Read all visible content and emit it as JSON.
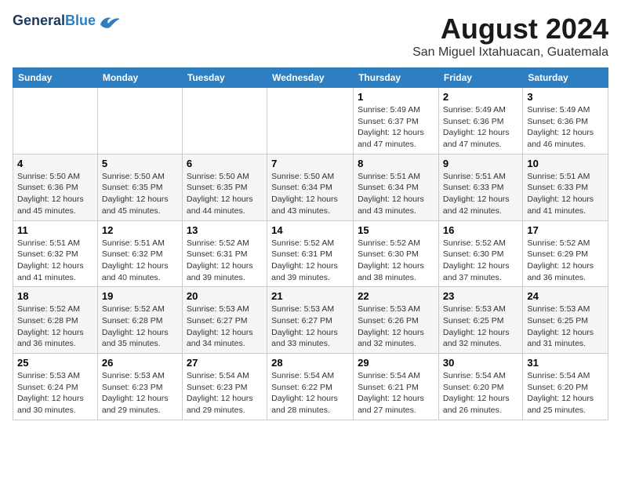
{
  "header": {
    "logo_general": "General",
    "logo_blue": "Blue",
    "month_title": "August 2024",
    "location": "San Miguel Ixtahuacan, Guatemala"
  },
  "days_of_week": [
    "Sunday",
    "Monday",
    "Tuesday",
    "Wednesday",
    "Thursday",
    "Friday",
    "Saturday"
  ],
  "weeks": [
    [
      {
        "day": "",
        "info": ""
      },
      {
        "day": "",
        "info": ""
      },
      {
        "day": "",
        "info": ""
      },
      {
        "day": "",
        "info": ""
      },
      {
        "day": "1",
        "info": "Sunrise: 5:49 AM\nSunset: 6:37 PM\nDaylight: 12 hours\nand 47 minutes."
      },
      {
        "day": "2",
        "info": "Sunrise: 5:49 AM\nSunset: 6:36 PM\nDaylight: 12 hours\nand 47 minutes."
      },
      {
        "day": "3",
        "info": "Sunrise: 5:49 AM\nSunset: 6:36 PM\nDaylight: 12 hours\nand 46 minutes."
      }
    ],
    [
      {
        "day": "4",
        "info": "Sunrise: 5:50 AM\nSunset: 6:36 PM\nDaylight: 12 hours\nand 45 minutes."
      },
      {
        "day": "5",
        "info": "Sunrise: 5:50 AM\nSunset: 6:35 PM\nDaylight: 12 hours\nand 45 minutes."
      },
      {
        "day": "6",
        "info": "Sunrise: 5:50 AM\nSunset: 6:35 PM\nDaylight: 12 hours\nand 44 minutes."
      },
      {
        "day": "7",
        "info": "Sunrise: 5:50 AM\nSunset: 6:34 PM\nDaylight: 12 hours\nand 43 minutes."
      },
      {
        "day": "8",
        "info": "Sunrise: 5:51 AM\nSunset: 6:34 PM\nDaylight: 12 hours\nand 43 minutes."
      },
      {
        "day": "9",
        "info": "Sunrise: 5:51 AM\nSunset: 6:33 PM\nDaylight: 12 hours\nand 42 minutes."
      },
      {
        "day": "10",
        "info": "Sunrise: 5:51 AM\nSunset: 6:33 PM\nDaylight: 12 hours\nand 41 minutes."
      }
    ],
    [
      {
        "day": "11",
        "info": "Sunrise: 5:51 AM\nSunset: 6:32 PM\nDaylight: 12 hours\nand 41 minutes."
      },
      {
        "day": "12",
        "info": "Sunrise: 5:51 AM\nSunset: 6:32 PM\nDaylight: 12 hours\nand 40 minutes."
      },
      {
        "day": "13",
        "info": "Sunrise: 5:52 AM\nSunset: 6:31 PM\nDaylight: 12 hours\nand 39 minutes."
      },
      {
        "day": "14",
        "info": "Sunrise: 5:52 AM\nSunset: 6:31 PM\nDaylight: 12 hours\nand 39 minutes."
      },
      {
        "day": "15",
        "info": "Sunrise: 5:52 AM\nSunset: 6:30 PM\nDaylight: 12 hours\nand 38 minutes."
      },
      {
        "day": "16",
        "info": "Sunrise: 5:52 AM\nSunset: 6:30 PM\nDaylight: 12 hours\nand 37 minutes."
      },
      {
        "day": "17",
        "info": "Sunrise: 5:52 AM\nSunset: 6:29 PM\nDaylight: 12 hours\nand 36 minutes."
      }
    ],
    [
      {
        "day": "18",
        "info": "Sunrise: 5:52 AM\nSunset: 6:28 PM\nDaylight: 12 hours\nand 36 minutes."
      },
      {
        "day": "19",
        "info": "Sunrise: 5:52 AM\nSunset: 6:28 PM\nDaylight: 12 hours\nand 35 minutes."
      },
      {
        "day": "20",
        "info": "Sunrise: 5:53 AM\nSunset: 6:27 PM\nDaylight: 12 hours\nand 34 minutes."
      },
      {
        "day": "21",
        "info": "Sunrise: 5:53 AM\nSunset: 6:27 PM\nDaylight: 12 hours\nand 33 minutes."
      },
      {
        "day": "22",
        "info": "Sunrise: 5:53 AM\nSunset: 6:26 PM\nDaylight: 12 hours\nand 32 minutes."
      },
      {
        "day": "23",
        "info": "Sunrise: 5:53 AM\nSunset: 6:25 PM\nDaylight: 12 hours\nand 32 minutes."
      },
      {
        "day": "24",
        "info": "Sunrise: 5:53 AM\nSunset: 6:25 PM\nDaylight: 12 hours\nand 31 minutes."
      }
    ],
    [
      {
        "day": "25",
        "info": "Sunrise: 5:53 AM\nSunset: 6:24 PM\nDaylight: 12 hours\nand 30 minutes."
      },
      {
        "day": "26",
        "info": "Sunrise: 5:53 AM\nSunset: 6:23 PM\nDaylight: 12 hours\nand 29 minutes."
      },
      {
        "day": "27",
        "info": "Sunrise: 5:54 AM\nSunset: 6:23 PM\nDaylight: 12 hours\nand 29 minutes."
      },
      {
        "day": "28",
        "info": "Sunrise: 5:54 AM\nSunset: 6:22 PM\nDaylight: 12 hours\nand 28 minutes."
      },
      {
        "day": "29",
        "info": "Sunrise: 5:54 AM\nSunset: 6:21 PM\nDaylight: 12 hours\nand 27 minutes."
      },
      {
        "day": "30",
        "info": "Sunrise: 5:54 AM\nSunset: 6:20 PM\nDaylight: 12 hours\nand 26 minutes."
      },
      {
        "day": "31",
        "info": "Sunrise: 5:54 AM\nSunset: 6:20 PM\nDaylight: 12 hours\nand 25 minutes."
      }
    ]
  ]
}
